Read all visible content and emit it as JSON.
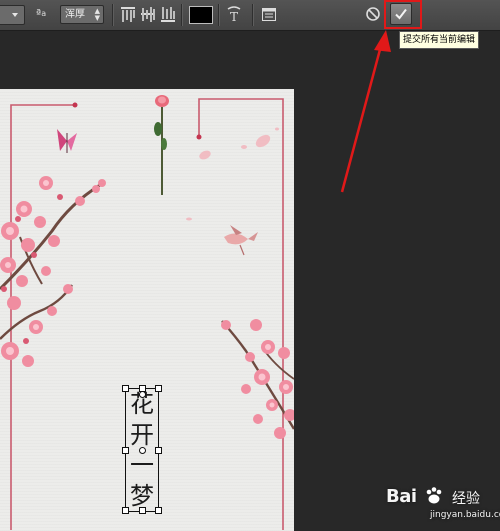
{
  "toolbar": {
    "antialias": {
      "value": "浑厚"
    },
    "text_color": "#000000",
    "commit_tooltip": "提交所有当前编辑"
  },
  "annotation": {
    "color": "#e01919"
  },
  "document": {
    "background": "#ececea",
    "vertical_text": [
      "花",
      "开",
      "一",
      "梦"
    ],
    "frame_color": "#c95b6e"
  },
  "watermark": {
    "brand": "Bai",
    "suffix": "经验",
    "url": "jingyan.baidu.com"
  }
}
